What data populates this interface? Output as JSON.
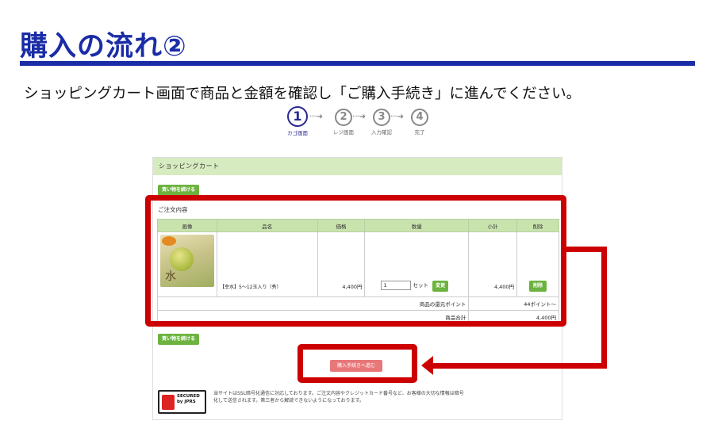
{
  "page": {
    "title": "購入の流れ②",
    "instruction": "ショッピングカート画面で商品と金額を確認し「ご購入手続き」に進んでください。"
  },
  "steps": [
    {
      "number": "1",
      "label": "カゴ画面",
      "active": true
    },
    {
      "number": "2",
      "label": "レジ画面",
      "active": false
    },
    {
      "number": "3",
      "label": "入力確認",
      "active": false
    },
    {
      "number": "4",
      "label": "完了",
      "active": false
    }
  ],
  "steps_separator": "····➜",
  "cart": {
    "header": "ショッピングカート",
    "continue_shopping_top": "買い物を続ける",
    "order_section_title": "ご注文内容",
    "columns": [
      "画像",
      "品名",
      "価格",
      "数量",
      "小計",
      "削除"
    ],
    "items": [
      {
        "image_kanji": "水",
        "name": "【幸水】5～12玉入り（秀）",
        "price": "4,400円",
        "quantity": "1",
        "quantity_unit": "セット",
        "change_button": "変更",
        "subtotal": "4,400円",
        "delete_button": "削除"
      }
    ],
    "points_label": "商品の還元ポイント",
    "points_value": "44ポイント～",
    "total_label": "商品合計",
    "total_value": "4,400円",
    "continue_shopping_bottom": "買い物を続ける",
    "proceed_button": "購入手続きへ進む"
  },
  "ssl": {
    "badge_line1": "SECURED",
    "badge_line2": "by JPRS",
    "note": "当サイトはSSL暗号化通信に対応しております。ご注文内容やクレジットカード番号など、お客様の大切な情報は暗号化して送信されます。第三者から解読できないようになっております。"
  },
  "colors": {
    "title_blue": "#1a2ca6",
    "highlight_red": "#cc0000",
    "cart_green": "#d7ebc0",
    "button_green": "#6db33f",
    "proceed_pink": "#e87779"
  }
}
